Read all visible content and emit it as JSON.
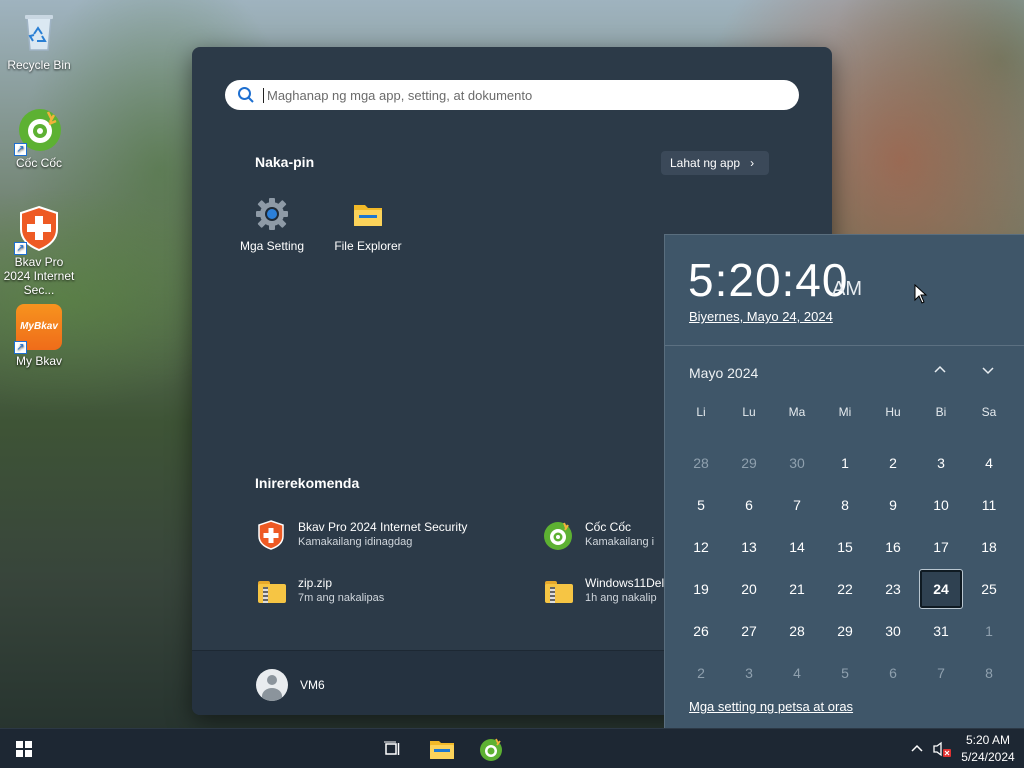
{
  "desktop": {
    "icons": [
      {
        "label": "Recycle Bin",
        "icon": "recycle-bin-icon"
      },
      {
        "label": "Cốc Cốc",
        "icon": "coccoc-icon"
      },
      {
        "label": "Bkav Pro 2024 Internet Sec...",
        "icon": "bkav-icon"
      },
      {
        "label": "My Bkav",
        "icon": "mybkav-icon",
        "icon_text": "MyBkav"
      }
    ]
  },
  "start_menu": {
    "search_placeholder": "Maghanap ng mga app, setting, at dokumento",
    "pinned_title": "Naka-pin",
    "all_apps_label": "Lahat ng app",
    "pinned": [
      {
        "label": "Mga Setting",
        "icon": "settings-gear-icon"
      },
      {
        "label": "File Explorer",
        "icon": "file-explorer-icon"
      }
    ],
    "recommended_title": "Inirerekomenda",
    "recommended": [
      {
        "name": "Bkav Pro 2024 Internet Security",
        "sub": "Kamakailang idinagdag",
        "icon": "bkav-icon"
      },
      {
        "name": "Cốc Cốc",
        "sub": "Kamakailang i",
        "icon": "coccoc-icon"
      },
      {
        "name": "zip.zip",
        "sub": "7m ang nakalipas",
        "icon": "zip-folder-icon"
      },
      {
        "name": "Windows11Del",
        "sub": "1h ang nakalip",
        "icon": "zip-folder-icon"
      }
    ],
    "user_name": "VM6"
  },
  "calendar": {
    "time": "5:20:40",
    "ampm": "AM",
    "long_date": "Biyernes, Mayo 24, 2024",
    "month_label": "Mayo 2024",
    "weekdays": [
      "Li",
      "Lu",
      "Ma",
      "Mi",
      "Hu",
      "Bi",
      "Sa"
    ],
    "weeks": [
      [
        "28",
        "29",
        "30",
        "1",
        "2",
        "3",
        "4"
      ],
      [
        "5",
        "6",
        "7",
        "8",
        "9",
        "10",
        "11"
      ],
      [
        "12",
        "13",
        "14",
        "15",
        "16",
        "17",
        "18"
      ],
      [
        "19",
        "20",
        "21",
        "22",
        "23",
        "24",
        "25"
      ],
      [
        "26",
        "27",
        "28",
        "29",
        "30",
        "31",
        "1"
      ],
      [
        "2",
        "3",
        "4",
        "5",
        "6",
        "7",
        "8"
      ]
    ],
    "today": "24",
    "settings_link": "Mga setting ng petsa at oras"
  },
  "taskbar": {
    "time": "5:20 AM",
    "date": "5/24/2024"
  },
  "colors": {
    "start_bg": "#2c3a48",
    "calendar_bg": "#3f5669",
    "taskbar_bg": "#1d2733",
    "accent": "#1e6fd0"
  }
}
